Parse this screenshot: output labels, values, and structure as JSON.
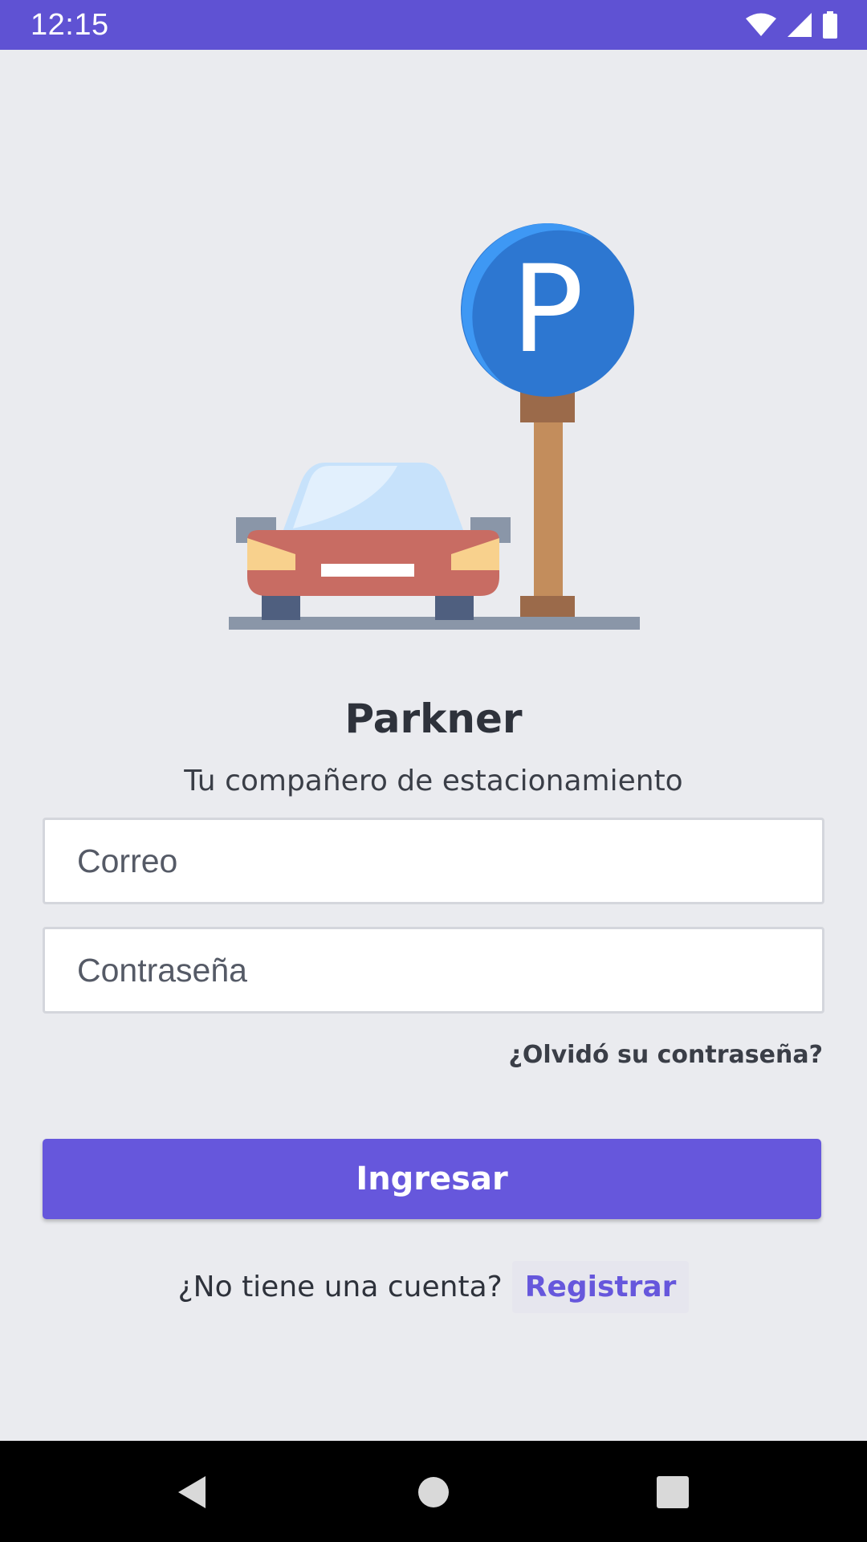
{
  "status_bar": {
    "time": "12:15",
    "icons": [
      "wifi-icon",
      "cellular-signal-icon",
      "battery-icon"
    ],
    "color": "#5f52d3"
  },
  "illustration": {
    "sign_letter": "P",
    "icons": [
      "car-icon",
      "parking-sign-icon"
    ]
  },
  "app": {
    "title": "Parkner",
    "subtitle": "Tu compañero de estacionamiento"
  },
  "form": {
    "email_placeholder": "Correo",
    "password_placeholder": "Contraseña",
    "email_value": "",
    "password_value": "",
    "forgot_password": "¿Olvidó su contraseña?",
    "login_button": "Ingresar"
  },
  "register": {
    "question": "¿No tiene una cuenta?",
    "link": "Registrar"
  },
  "nav_bar": {
    "icons": [
      "back-icon",
      "home-icon",
      "recents-icon"
    ]
  },
  "colors": {
    "accent": "#6657dc",
    "background": "#eaebef",
    "text": "#2e323b"
  }
}
